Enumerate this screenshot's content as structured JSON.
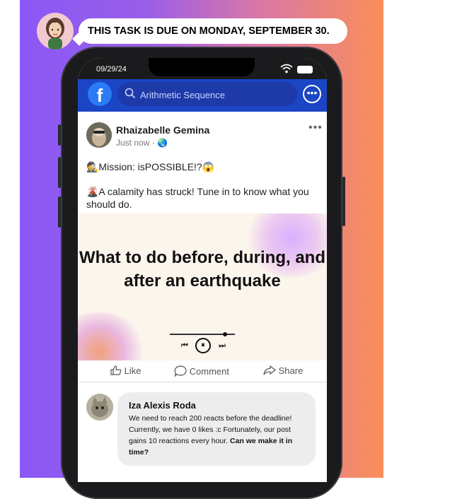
{
  "banner": {
    "text": "THIS TASK IS DUE ON MONDAY, SEPTEMBER 30."
  },
  "status_bar": {
    "date": "09/29/24"
  },
  "facebook": {
    "logo": "f",
    "search_placeholder": "Arithmetic Sequence",
    "more_icon": "ellipsis-circle-icon"
  },
  "post": {
    "author": "Rhaizabelle Gemina",
    "meta": "Just now · 🌏",
    "options_icon": "•••",
    "line1": "🕵Mission: isPOSSIBLE!?😱",
    "line2": "🌋A calamity has struck! Tune in to know what you should do.",
    "media_title": "What to do before, during, and after an earthquake",
    "media_progress": 0.85,
    "controls": {
      "prev": "⏮",
      "play": "⏸",
      "next": "⏭"
    }
  },
  "actions": {
    "like": "Like",
    "comment": "Comment",
    "share": "Share"
  },
  "comment": {
    "author": "Iza Alexis Roda",
    "text_plain": "We need to reach 200 reacts before the deadline! Currently, we have 0 likes :c Fortunately, our post gains 10 reactions every hour.",
    "text_bold": "Can we make it in time?"
  },
  "colors": {
    "fb_blue": "#1a45c4",
    "gradient_start": "#8a58f6",
    "gradient_end": "#f98f58"
  }
}
